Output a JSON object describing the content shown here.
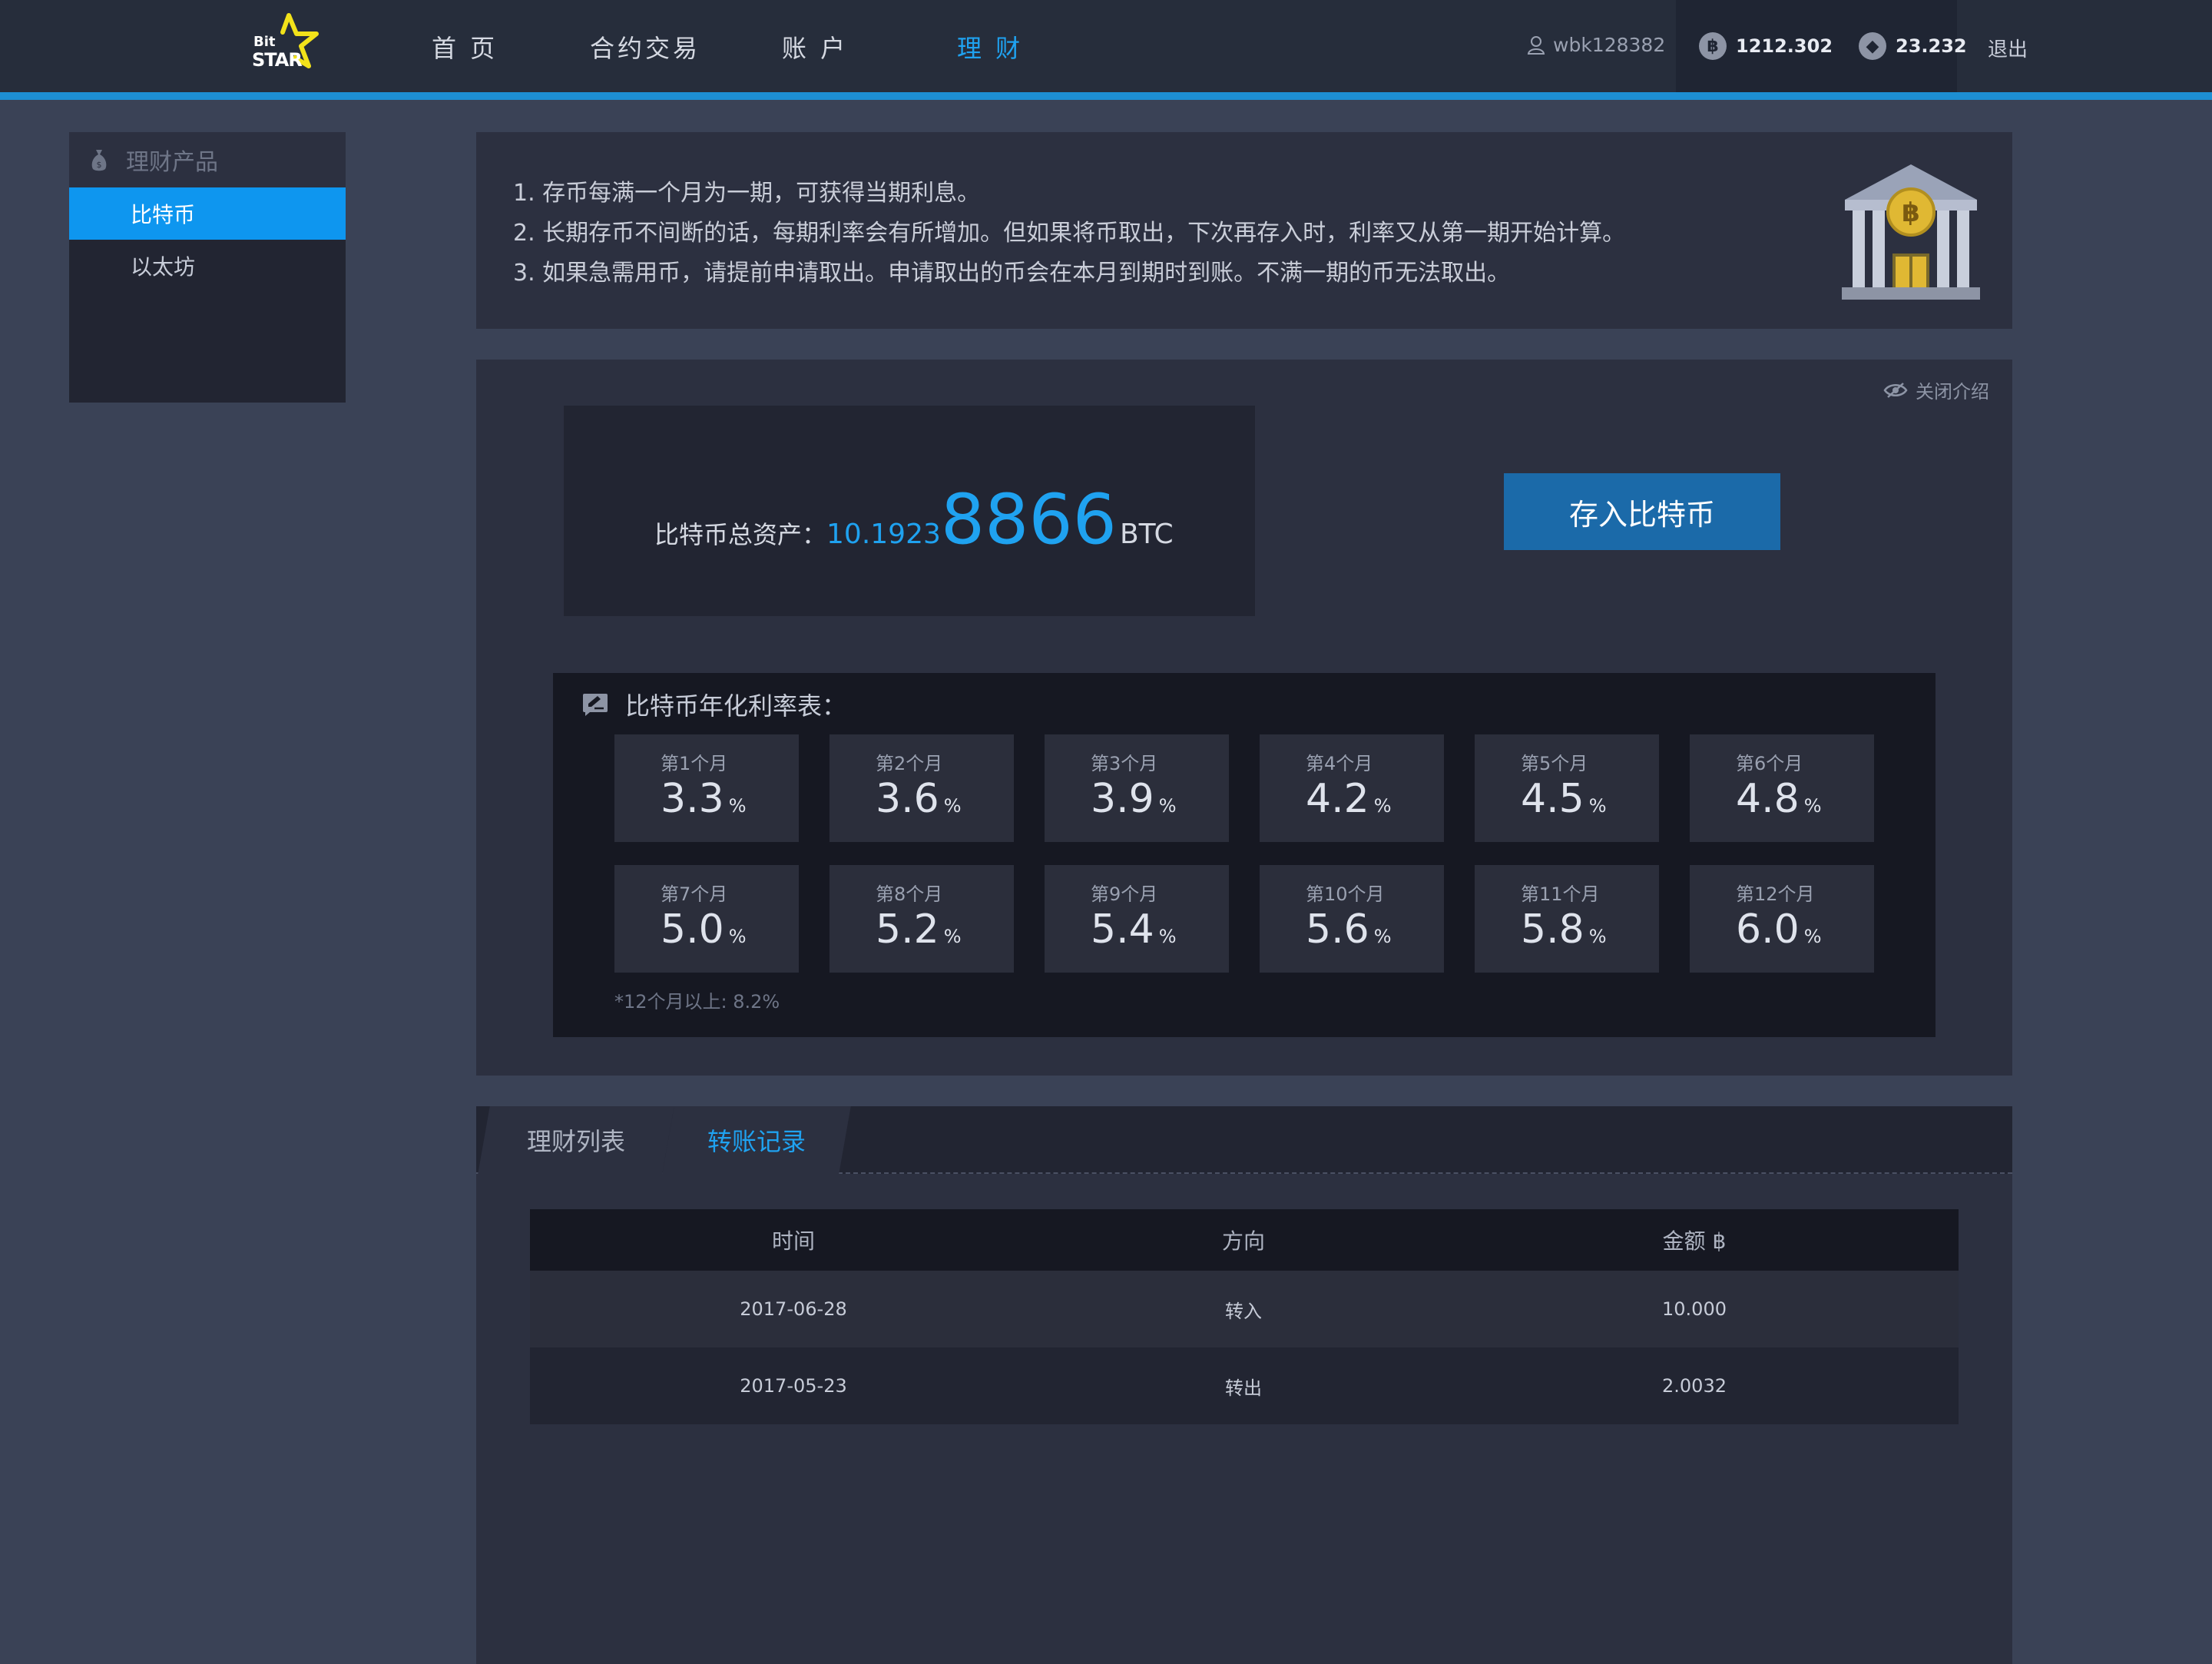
{
  "header": {
    "logo": {
      "line1": "Bit",
      "line2": "STAR"
    },
    "nav": [
      "首 页",
      "合约交易",
      "账 户",
      "理 财"
    ],
    "active_nav": 3,
    "user": "wbk128382",
    "balances": [
      {
        "icon": "bitcoin-icon",
        "value": "1212.302"
      },
      {
        "icon": "ethereum-icon",
        "value": "23.232"
      }
    ],
    "logout": "退出"
  },
  "sidebar": {
    "title": "理财产品",
    "items": [
      "比特币",
      "以太坊"
    ],
    "active": 0
  },
  "intro": {
    "lines": [
      "1. 存币每满一个月为一期，可获得当期利息。",
      "2. 长期存币不间断的话，每期利率会有所增加。但如果将币取出，下次再存入时，利率又从第一期开始计算。",
      "3. 如果急需用币，请提前申请取出。申请取出的币会在本月到期时到账。不满一期的币无法取出。"
    ]
  },
  "summary": {
    "close_intro": "关闭介绍",
    "asset_label": "比特币总资产：",
    "asset_prefix": "10.1923",
    "asset_big": "8866",
    "asset_unit": "BTC",
    "deposit_button": "存入比特币"
  },
  "rates": {
    "title": "比特币年化利率表：",
    "items": [
      {
        "month": "第1个月",
        "rate": "3.3"
      },
      {
        "month": "第2个月",
        "rate": "3.6"
      },
      {
        "month": "第3个月",
        "rate": "3.9"
      },
      {
        "month": "第4个月",
        "rate": "4.2"
      },
      {
        "month": "第5个月",
        "rate": "4.5"
      },
      {
        "month": "第6个月",
        "rate": "4.8"
      },
      {
        "month": "第7个月",
        "rate": "5.0"
      },
      {
        "month": "第8个月",
        "rate": "5.2"
      },
      {
        "month": "第9个月",
        "rate": "5.4"
      },
      {
        "month": "第10个月",
        "rate": "5.6"
      },
      {
        "month": "第11个月",
        "rate": "5.8"
      },
      {
        "month": "第12个月",
        "rate": "6.0"
      }
    ],
    "percent": "%",
    "note": "*12个月以上: 8.2%"
  },
  "records": {
    "tabs": [
      "理财列表",
      "转账记录"
    ],
    "active_tab": 1,
    "columns": [
      "时间",
      "方向",
      "金额 ฿"
    ],
    "rows": [
      [
        "2017-06-28",
        "转入",
        "10.000"
      ],
      [
        "2017-05-23",
        "转出",
        "2.0032"
      ]
    ]
  }
}
